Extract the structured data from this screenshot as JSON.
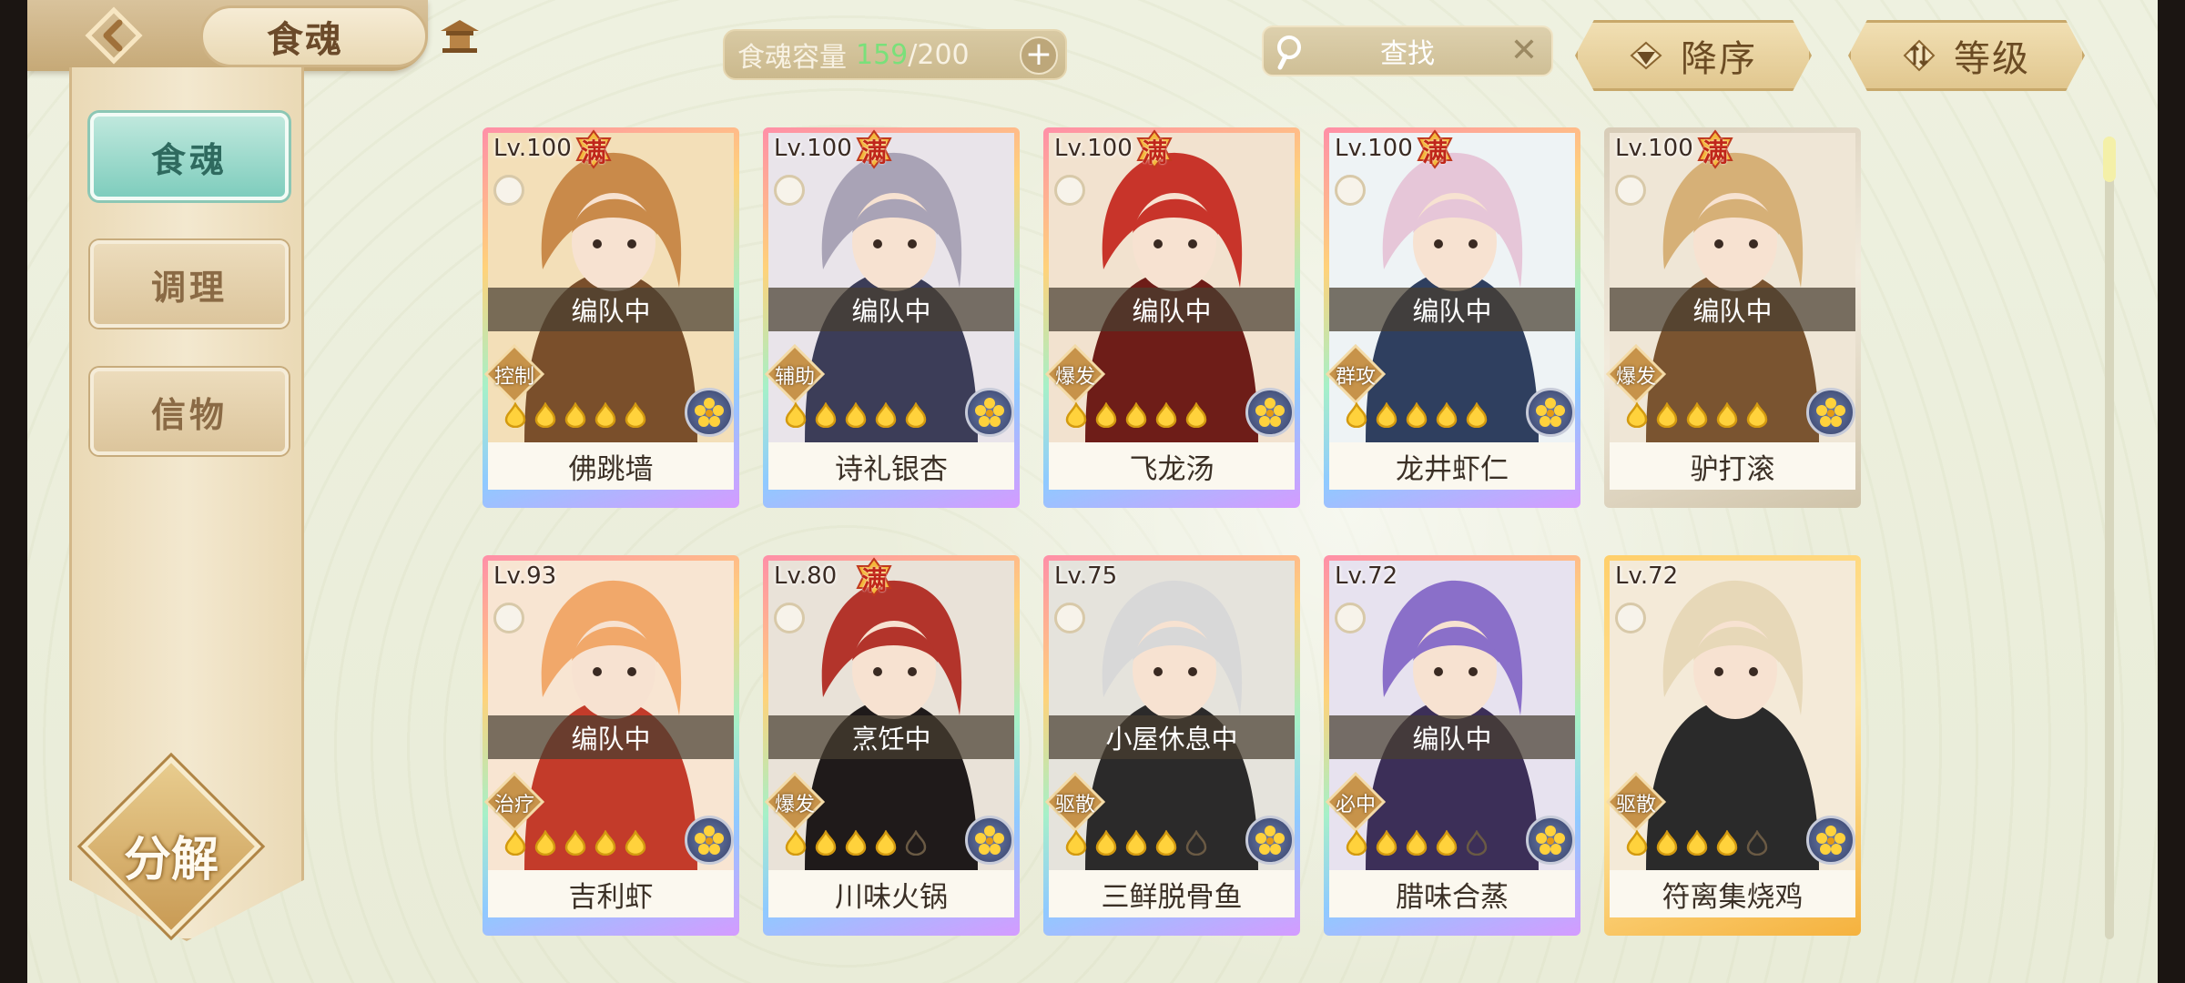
{
  "header": {
    "title": "食魂",
    "capacity_label": "食魂容量",
    "capacity_current": "159",
    "capacity_max": "/200",
    "search_placeholder": "查找",
    "sort_order_label": "降序",
    "sort_field_label": "等级"
  },
  "sidebar": {
    "items": [
      {
        "label": "食魂",
        "active": true
      },
      {
        "label": "调理",
        "active": false
      },
      {
        "label": "信物",
        "active": false
      }
    ],
    "decompose_label": "分解"
  },
  "colors": {
    "accent_teal": "#7fcdbd",
    "capacity_green": "#7ae07a",
    "status_overlay": "#483e30"
  },
  "cards": [
    {
      "level": "Lv.100",
      "full_badge": "满",
      "status": "编队中",
      "role": "控制",
      "name": "佛跳墙",
      "stars": 5,
      "frame": "rainbow"
    },
    {
      "level": "Lv.100",
      "full_badge": "满",
      "status": "编队中",
      "role": "辅助",
      "name": "诗礼银杏",
      "stars": 5,
      "frame": "rainbow"
    },
    {
      "level": "Lv.100",
      "full_badge": "满",
      "status": "编队中",
      "role": "爆发",
      "name": "飞龙汤",
      "stars": 5,
      "frame": "rainbow"
    },
    {
      "level": "Lv.100",
      "full_badge": "满",
      "status": "编队中",
      "role": "群攻",
      "name": "龙井虾仁",
      "stars": 5,
      "frame": "rainbow"
    },
    {
      "level": "Lv.100",
      "full_badge": "满",
      "status": "编队中",
      "role": "爆发",
      "name": "驴打滚",
      "stars": 5,
      "frame": "plain"
    },
    {
      "level": "Lv.93",
      "full_badge": "",
      "status": "编队中",
      "role": "治疗",
      "name": "吉利虾",
      "stars": 5,
      "frame": "rainbow"
    },
    {
      "level": "Lv.80",
      "full_badge": "满",
      "status": "烹饪中",
      "role": "爆发",
      "name": "川味火锅",
      "stars": 4,
      "frame": "rainbow"
    },
    {
      "level": "Lv.75",
      "full_badge": "",
      "status": "小屋休息中",
      "role": "驱散",
      "name": "三鲜脱骨鱼",
      "stars": 4,
      "frame": "rainbow"
    },
    {
      "level": "Lv.72",
      "full_badge": "",
      "status": "编队中",
      "role": "必中",
      "name": "腊味合蒸",
      "stars": 4,
      "frame": "rainbow"
    },
    {
      "level": "Lv.72",
      "full_badge": "",
      "status": "",
      "role": "驱散",
      "name": "符离集烧鸡",
      "stars": 4,
      "frame": "gold"
    }
  ]
}
